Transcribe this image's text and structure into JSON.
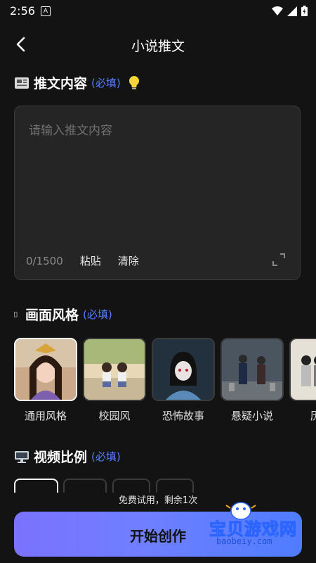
{
  "status_bar": {
    "time": "2:56",
    "notif_icon": "A"
  },
  "navbar": {
    "title": "小说推文"
  },
  "content_section": {
    "title": "推文内容",
    "required": "(必填)",
    "placeholder": "请输入推文内容",
    "char_count": "0/1500",
    "paste_label": "粘贴",
    "clear_label": "清除"
  },
  "style_section": {
    "title": "画面风格",
    "required": "(必填)",
    "styles": [
      {
        "label": "通用风格",
        "selected": true
      },
      {
        "label": "校园风",
        "selected": false
      },
      {
        "label": "恐怖故事",
        "selected": false
      },
      {
        "label": "悬疑小说",
        "selected": false
      },
      {
        "label": "历史",
        "selected": false
      }
    ]
  },
  "ratio_section": {
    "title": "视频比例",
    "required": "(必填)"
  },
  "footer": {
    "trial_text": "免费试用，剩余1次",
    "start_label": "开始创作"
  },
  "watermark": {
    "text": "宝贝游戏网",
    "url": "baobeiy.com"
  },
  "colors": {
    "background": "#131313",
    "accent": "#5a7cff",
    "card": "#252525"
  }
}
